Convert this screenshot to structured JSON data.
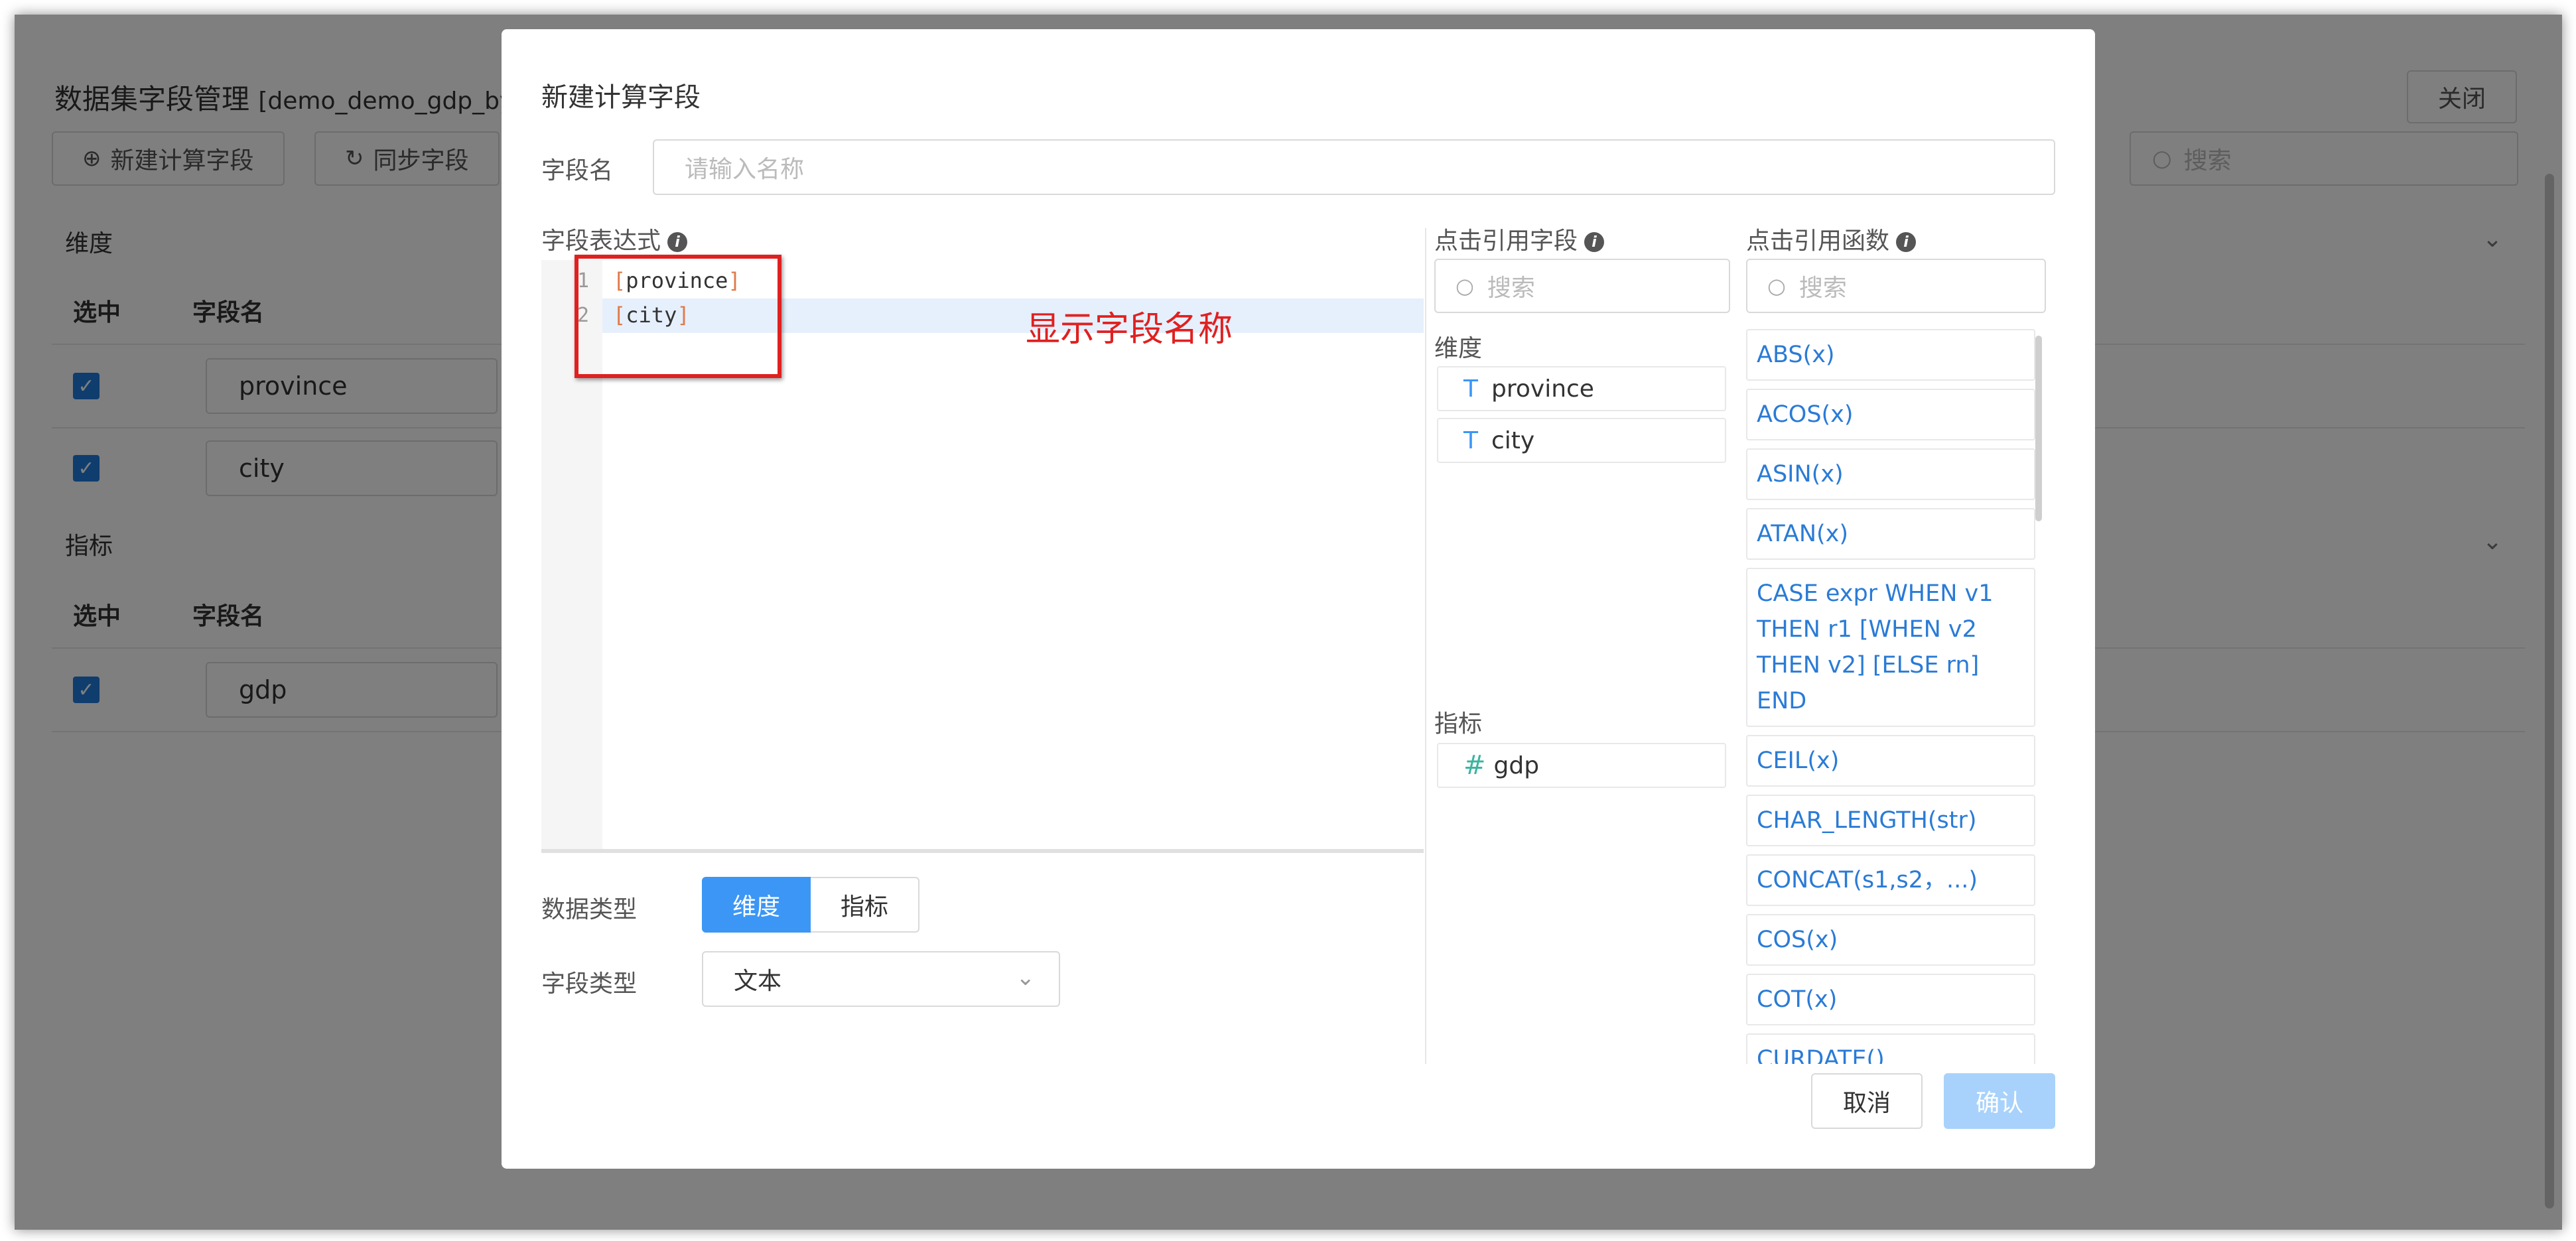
{
  "background": {
    "title": "数据集字段管理",
    "subtitle": "[demo_demo_gdp_by",
    "buttons": {
      "new_calc_field": "新建计算字段",
      "sync_fields": "同步字段",
      "close": "关闭"
    },
    "search_placeholder": "搜索",
    "dimension_section": "维度",
    "measure_section": "指标",
    "col_selected": "选中",
    "col_field_name": "字段名",
    "dimension_rows": [
      "province",
      "city"
    ],
    "measure_rows": [
      "gdp"
    ]
  },
  "modal": {
    "title": "新建计算字段",
    "field_name_label": "字段名",
    "field_name_placeholder": "请输入名称",
    "expression_label": "字段表达式",
    "editor": {
      "lines": [
        {
          "no": "1",
          "text": "province"
        },
        {
          "no": "2",
          "text": "city"
        }
      ]
    },
    "annotation": "显示字段名称",
    "data_type_label": "数据类型",
    "data_type_options": [
      "维度",
      "指标"
    ],
    "data_type_selected": "维度",
    "field_type_label": "字段类型",
    "field_type_value": "文本",
    "ref_field_label": "点击引用字段",
    "ref_field_search": "搜索",
    "ref_dimension_label": "维度",
    "ref_dimensions": [
      "province",
      "city"
    ],
    "ref_measure_label": "指标",
    "ref_measures": [
      "gdp"
    ],
    "ref_func_label": "点击引用函数",
    "ref_func_search": "搜索",
    "functions": [
      "ABS(x)",
      "ACOS(x)",
      "ASIN(x)",
      "ATAN(x)",
      "CASE expr WHEN v1 THEN r1 [WHEN v2 THEN v2] [ELSE rn] END",
      "CEIL(x)",
      "CHAR_LENGTH(str)",
      "CONCAT(s1,s2，...)",
      "COS(x)",
      "COT(x)",
      "CURDATE()"
    ],
    "cancel": "取消",
    "confirm": "确认"
  },
  "colors": {
    "accent": "#3c96f5",
    "link": "#2a7bd6",
    "highlight": "#e02020",
    "confirm_disabled": "#a8d2fb"
  }
}
